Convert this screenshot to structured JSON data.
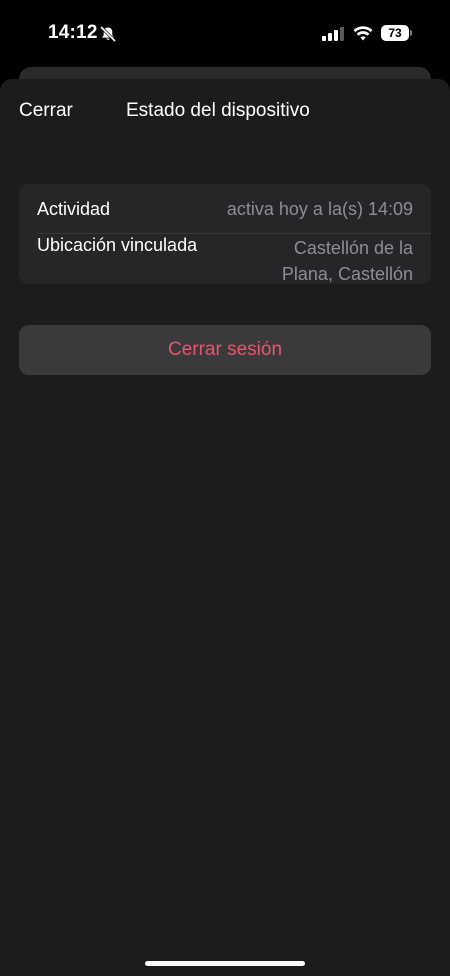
{
  "status_bar": {
    "time": "14:12",
    "battery": "73",
    "icons": [
      "bell-slash-icon",
      "cellular-signal-icon",
      "wifi-icon",
      "battery-icon"
    ]
  },
  "nav": {
    "close_label": "Cerrar",
    "title": "Estado del dispositivo"
  },
  "details": {
    "rows": [
      {
        "label": "Actividad",
        "value": "activa hoy a la(s) 14:09"
      },
      {
        "label": "Ubicación vinculada",
        "value": "Castellón de la Plana, Castellón"
      }
    ]
  },
  "actions": {
    "logout_label": "Cerrar sesión"
  },
  "colors": {
    "background": "#1c1c1e",
    "card": "#262628",
    "button": "#3a3a3c",
    "destructive": "#e5576b",
    "secondary_text": "#8e8e93"
  }
}
